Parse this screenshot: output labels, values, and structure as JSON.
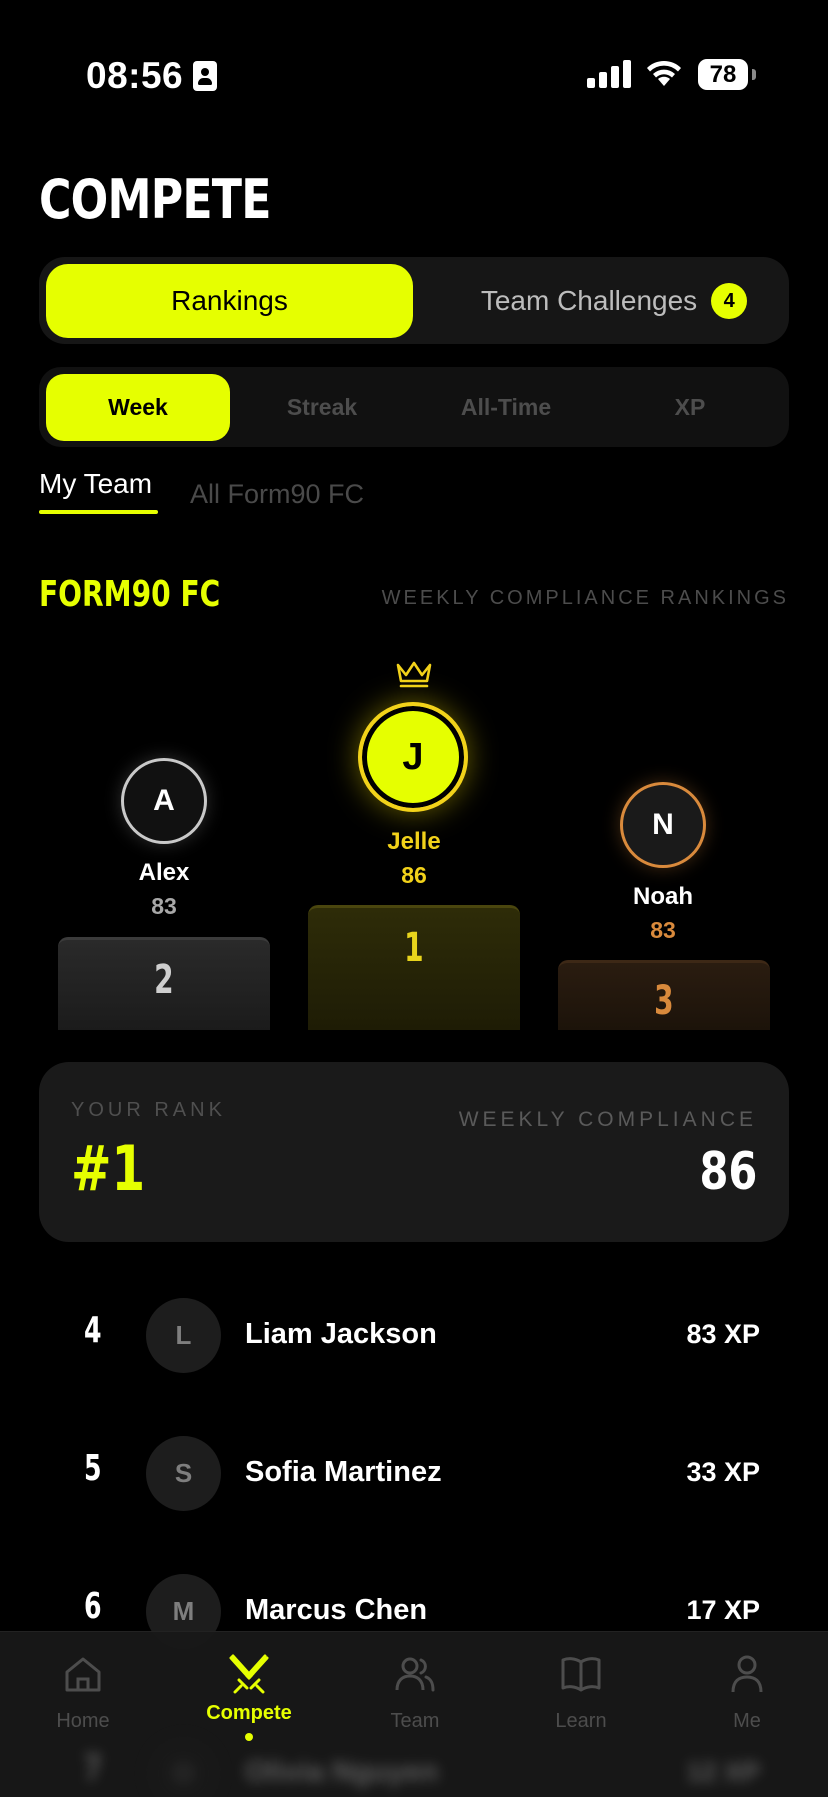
{
  "status_bar": {
    "time": "08:56",
    "battery": "78"
  },
  "header": {
    "title": "COMPETE"
  },
  "main_tabs": [
    {
      "label": "Rankings",
      "active": true
    },
    {
      "label": "Team Challenges",
      "badge": "4",
      "active": false
    }
  ],
  "period_tabs": [
    {
      "label": "Week",
      "active": true
    },
    {
      "label": "Streak",
      "active": false
    },
    {
      "label": "All-Time",
      "active": false
    },
    {
      "label": "XP",
      "active": false
    }
  ],
  "scope_tabs": [
    {
      "label": "My Team",
      "active": true
    },
    {
      "label": "All Form90 FC",
      "active": false
    }
  ],
  "section": {
    "club_name": "FORM90 FC",
    "subtitle": "WEEKLY COMPLIANCE RANKINGS"
  },
  "podium": {
    "first": {
      "initial": "J",
      "name": "Jelle",
      "score": "86",
      "place": "1"
    },
    "second": {
      "initial": "A",
      "name": "Alex",
      "score": "83",
      "place": "2"
    },
    "third": {
      "initial": "N",
      "name": "Noah",
      "score": "83",
      "place": "3"
    }
  },
  "your_rank": {
    "rank_label": "YOUR RANK",
    "rank_value": "#1",
    "compliance_label": "WEEKLY COMPLIANCE",
    "compliance_value": "86"
  },
  "leaderboard": [
    {
      "rank": "4",
      "initial": "L",
      "name": "Liam Jackson",
      "xp": "83 XP"
    },
    {
      "rank": "5",
      "initial": "S",
      "name": "Sofia Martinez",
      "xp": "33 XP"
    },
    {
      "rank": "6",
      "initial": "M",
      "name": "Marcus Chen",
      "xp": "17 XP"
    },
    {
      "rank": "7",
      "initial": "O",
      "name": "Olivia Nguyen",
      "xp": "12 XP"
    }
  ],
  "tab_bar": [
    {
      "label": "Home",
      "icon": "home-icon",
      "active": false
    },
    {
      "label": "Compete",
      "icon": "swords-icon",
      "active": true
    },
    {
      "label": "Team",
      "icon": "team-icon",
      "active": false
    },
    {
      "label": "Learn",
      "icon": "book-icon",
      "active": false
    },
    {
      "label": "Me",
      "icon": "person-icon",
      "active": false
    }
  ],
  "colors": {
    "accent": "#e6ff00",
    "gold": "#f2d21a",
    "bronze": "#d98a3c",
    "silver": "#c9c9c9",
    "background": "#000000"
  }
}
